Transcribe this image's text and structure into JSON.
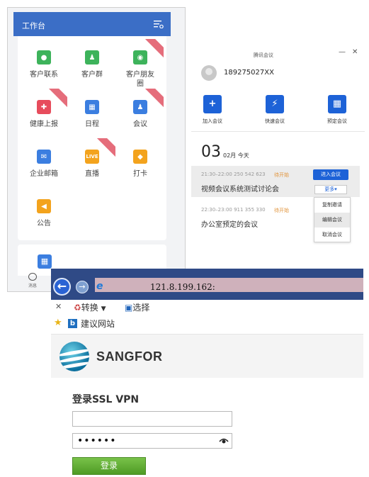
{
  "wecom": {
    "title": "工作台",
    "apps": [
      {
        "label": "客户联系",
        "icon": "chat-icon",
        "color": "#3db35b",
        "glyph": "●"
      },
      {
        "label": "客户群",
        "icon": "people-icon",
        "color": "#3db35b",
        "glyph": "♟"
      },
      {
        "label": "客户朋友\n圈",
        "icon": "camera-icon",
        "color": "#3db35b",
        "glyph": "◉"
      },
      {
        "label": "健康上报",
        "icon": "health-icon",
        "color": "#e74c5c",
        "glyph": "✚"
      },
      {
        "label": "日程",
        "icon": "calendar-icon",
        "color": "#3b7ee0",
        "glyph": "▦"
      },
      {
        "label": "会议",
        "icon": "meeting-icon",
        "color": "#3b7ee0",
        "glyph": "♟"
      },
      {
        "label": "企业邮箱",
        "icon": "mail-icon",
        "color": "#3b7ee0",
        "glyph": "✉"
      },
      {
        "label": "直播",
        "icon": "live-icon",
        "color": "#f3a31d",
        "glyph": "LIVE"
      },
      {
        "label": "打卡",
        "icon": "location-icon",
        "color": "#f3a31d",
        "glyph": "◆"
      },
      {
        "label": "公告",
        "icon": "announcement-icon",
        "color": "#f3a31d",
        "glyph": "◀"
      }
    ],
    "bottom_tab": "消息"
  },
  "meeting": {
    "app_title": "腾讯会议",
    "user_id": "189275027XX",
    "actions": [
      {
        "label": "加入会议",
        "glyph": "+"
      },
      {
        "label": "快速会议",
        "glyph": "⚡"
      },
      {
        "label": "预定会议",
        "glyph": "▦"
      }
    ],
    "day": "03",
    "month_label": "02月 今天",
    "meetings": [
      {
        "time": "21:30–22:00  250 542 623",
        "status": "待开始",
        "title": "视频会议系统测试讨论会"
      },
      {
        "time": "22:30–23:00  911 355 330",
        "status": "待开始",
        "title": "办公室预定的会议"
      }
    ],
    "join_label": "进入会议",
    "more_label": "更多▾",
    "dropdown": [
      "复制邀请",
      "编辑会议",
      "取消会议"
    ]
  },
  "browser": {
    "url": "121.8.199.162:",
    "convert_label": "转换",
    "select_label": "选择",
    "favorite_label": "建议网站",
    "brand": "SANGFOR",
    "login_title": "登录SSL VPN",
    "password_mask": "••••••",
    "login_button": "登录"
  }
}
